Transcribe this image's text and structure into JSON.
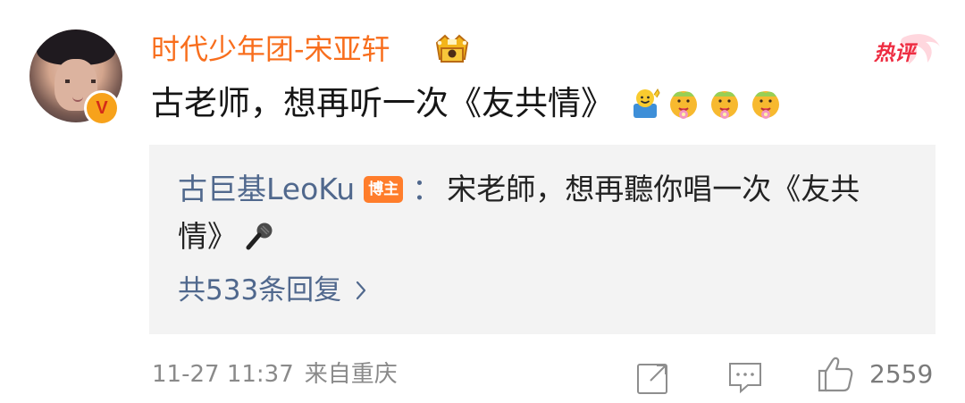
{
  "colors": {
    "username": "#f86e1d",
    "link": "#50688d",
    "text": "#161616",
    "meta": "#8a8a8a",
    "reply_bg": "#f3f3f3",
    "author_tag": "#ff7d2b"
  },
  "comment": {
    "avatar": {
      "badge_text": "V"
    },
    "username": "时代少年团-宋亚轩",
    "username_icon": "crown-icon",
    "hot_badge": "热评",
    "text": "古老师，想再听一次《友共情》",
    "emojis": [
      "wave-emoji",
      "flower-emoji",
      "flower-emoji",
      "flower-emoji"
    ]
  },
  "reply": {
    "author": "古巨基LeoKu",
    "author_tag": "博主",
    "colon": "：",
    "text_line1": "宋老師，想再聽你唱一次《友共",
    "text_line2": "情》",
    "emoji": "microphone-icon",
    "count_text": "共533条回复"
  },
  "footer": {
    "timestamp": "11-27 11:37",
    "source": "来自重庆",
    "like_count": "2559"
  }
}
